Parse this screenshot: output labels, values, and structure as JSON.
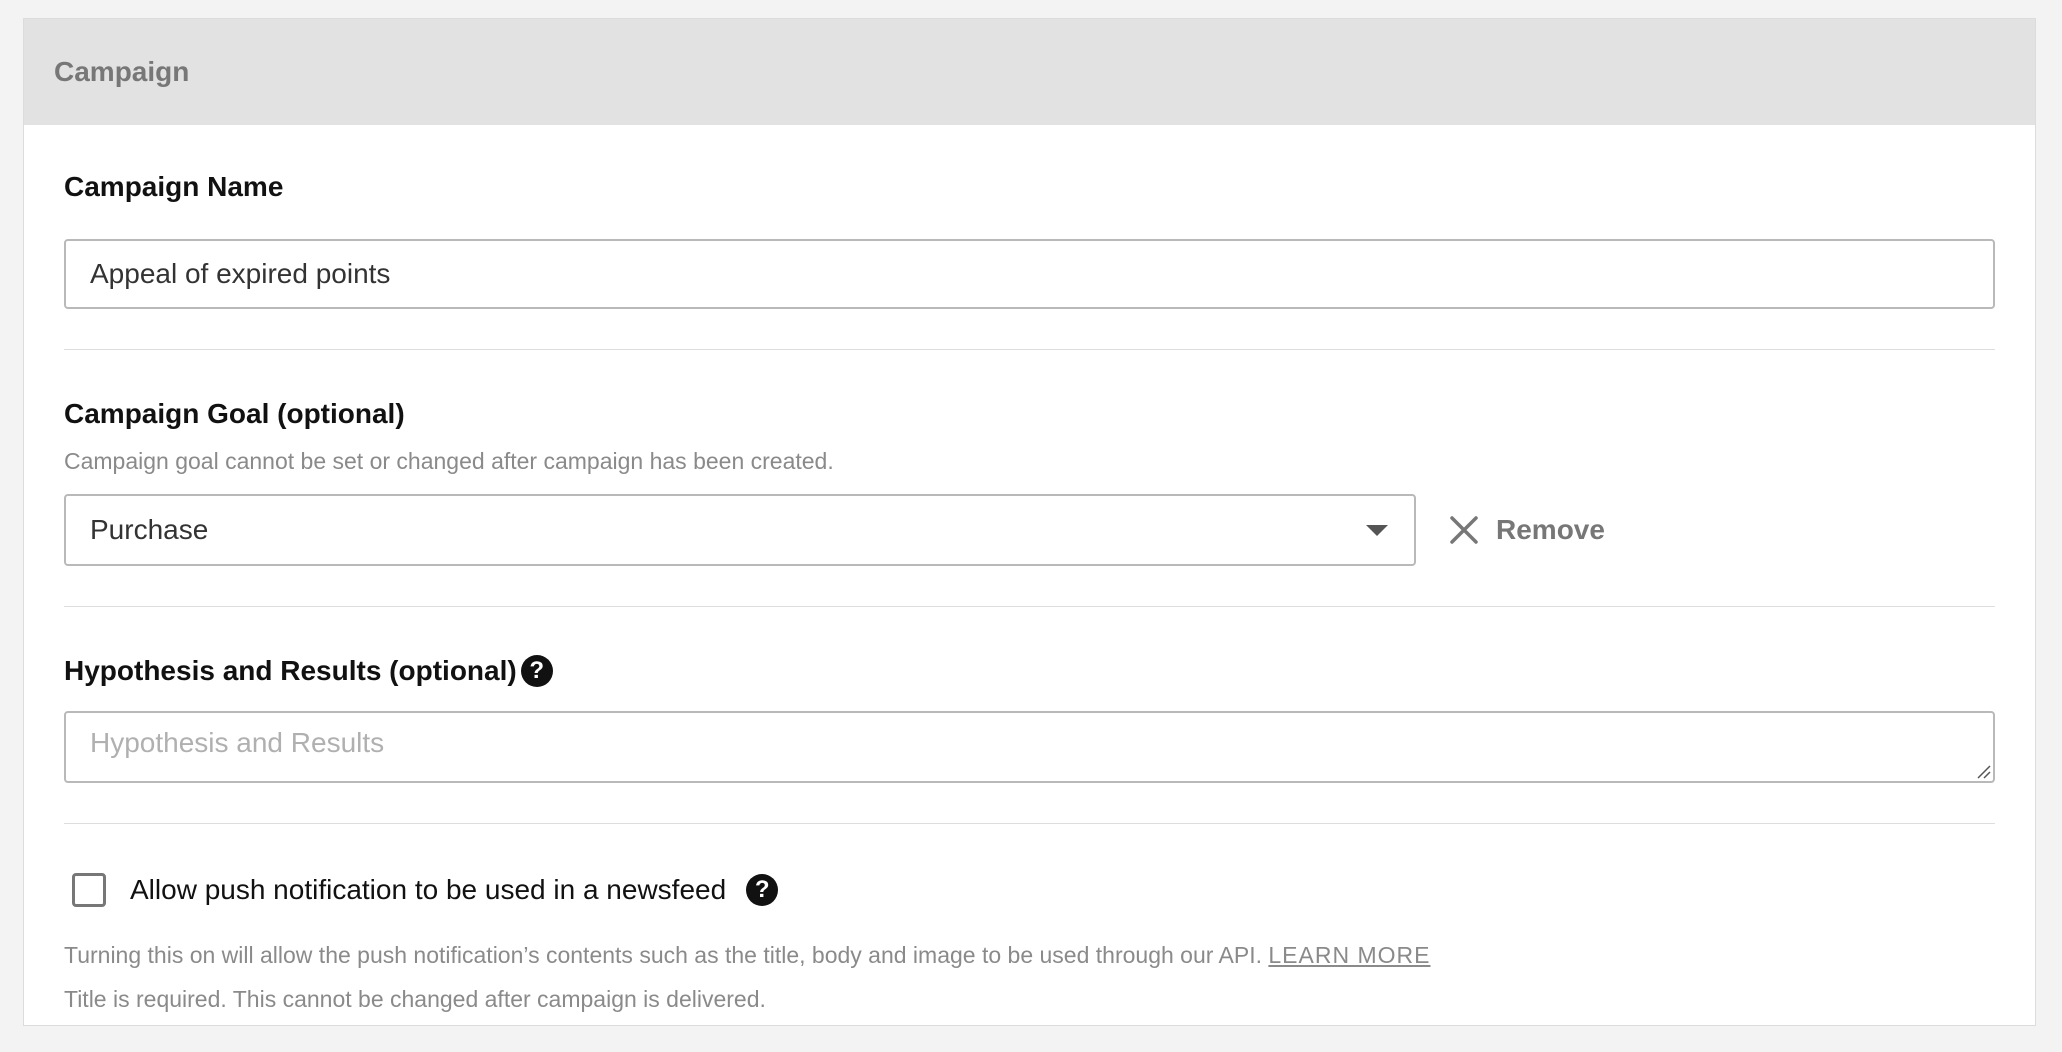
{
  "panel": {
    "title": "Campaign"
  },
  "campaign_name": {
    "label": "Campaign Name",
    "value": "Appeal of expired points"
  },
  "campaign_goal": {
    "label": "Campaign Goal (optional)",
    "help": "Campaign goal cannot be set or changed after campaign has been created.",
    "selected": "Purchase",
    "remove_label": "Remove"
  },
  "hypothesis": {
    "label": "Hypothesis and Results (optional)",
    "placeholder": "Hypothesis and Results",
    "help_icon": "question-circle-icon"
  },
  "push": {
    "checkbox_label": "Allow push notification to be used in a newsfeed",
    "checked": false,
    "help_text": "Turning this on will allow the push notification’s contents such as the title, body and image to be used through our API.",
    "learn_more": "LEARN MORE",
    "note": "Title is required. This cannot be changed after campaign is delivered.",
    "help_icon": "question-circle-icon"
  },
  "colors": {
    "header_bg": "#e2e2e2",
    "page_bg": "#f3f3f3",
    "muted_text": "#8a8a8a",
    "border": "#b9b9b9"
  }
}
